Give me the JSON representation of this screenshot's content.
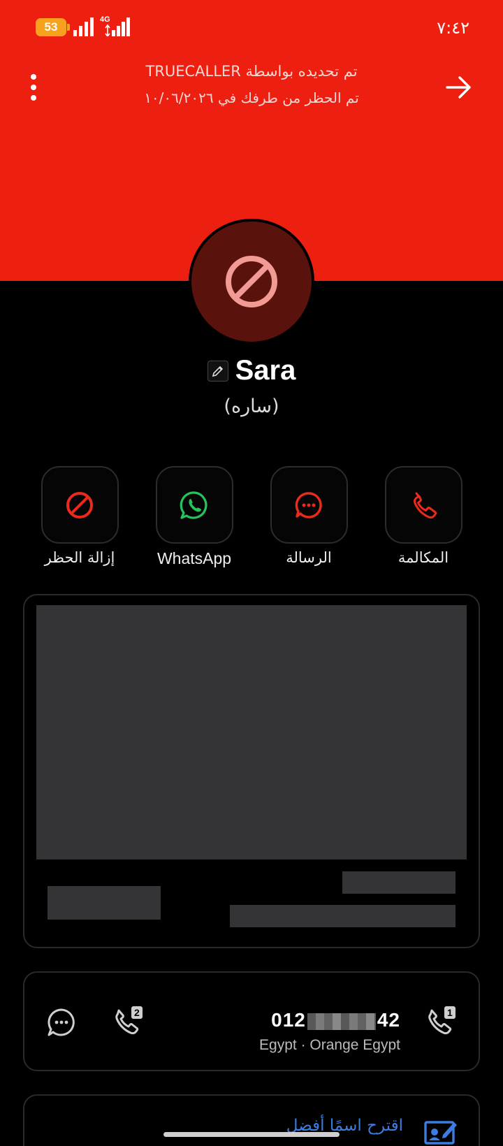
{
  "status_bar": {
    "battery": "53",
    "network": "4G",
    "time": "٧:٤٢"
  },
  "header": {
    "updated_by": "تم تحديده بواسطة TRUECALLER",
    "blocked_on": "تم الحظر من طرفك في ١٠/٠٦/٢٠٢٦",
    "bg_color": "#ec1f10"
  },
  "contact": {
    "name": "Sara",
    "alt_name": "(ساره)"
  },
  "actions": [
    {
      "label": "المكالمة",
      "icon": "phone-icon"
    },
    {
      "label": "الرسالة",
      "icon": "message-icon"
    },
    {
      "label": "WhatsApp",
      "icon": "whatsapp-icon"
    },
    {
      "label": "إزالة الحظر",
      "icon": "unblock-icon"
    }
  ],
  "number_card": {
    "number_start": "012",
    "number_end": "42",
    "carrier": "Egypt · Orange Egypt",
    "sim1": "1",
    "sim2": "2"
  },
  "suggest": {
    "label": "اقترح اسمًا أفضل"
  },
  "colors": {
    "accent_red": "#ec1f10",
    "whatsapp_green": "#25c45a",
    "link_blue": "#3b7de0"
  }
}
